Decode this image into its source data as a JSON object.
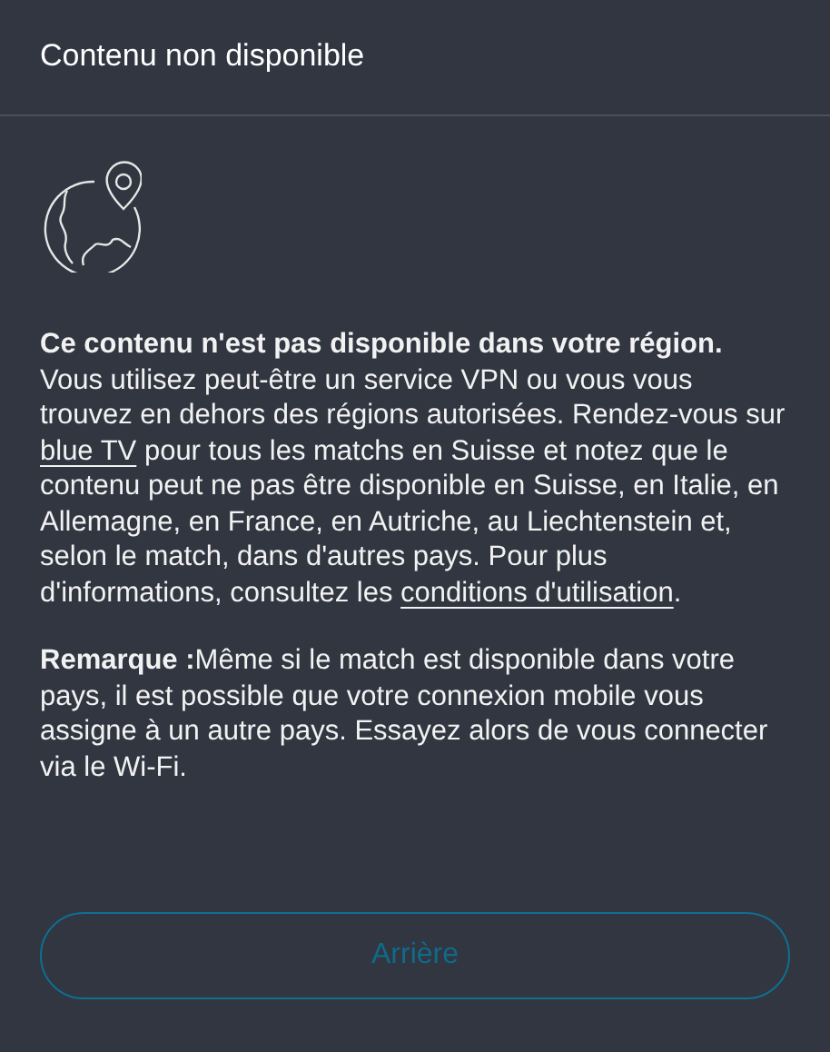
{
  "dialog": {
    "title": "Contenu non disponible"
  },
  "paragraphs": [
    [
      {
        "kind": "text",
        "text": "**Ce contenu n'est pas disponible dans votre région.** Vous utilisez peut-être un service VPN ou vous vous trouvez en dehors des régions autorisées. Rendez-vous sur "
      },
      {
        "kind": "link",
        "text": "blue TV"
      },
      {
        "kind": "text",
        "text": " pour tous les matchs en Suisse et notez que le contenu peut ne pas être disponible en Suisse, en Italie, en Allemagne, en France, en Autriche, au Liechtenstein et, selon le match, dans d'autres pays. Pour plus d'informations, consultez les "
      },
      {
        "kind": "link",
        "text": "conditions d'utilisation"
      },
      {
        "kind": "text",
        "text": "."
      }
    ],
    [
      {
        "kind": "text",
        "text": "**Remarque :**Même si le match est disponible dans votre pays, il est possible que votre connexion mobile vous assigne à un autre pays. Essayez alors de vous connecter via le Wi-Fi."
      }
    ]
  ],
  "button": {
    "label": "Arrière",
    "disabled": true
  }
}
